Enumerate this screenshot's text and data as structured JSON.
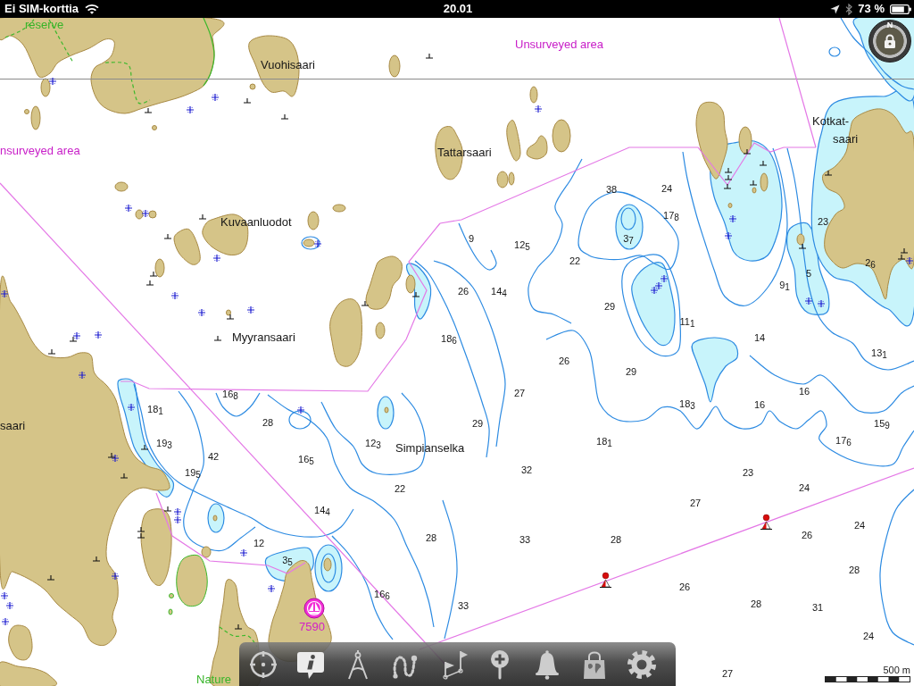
{
  "status_bar": {
    "carrier": "Ei SIM-korttia",
    "time": "20.01",
    "battery": "73 %"
  },
  "chart": {
    "labels": [
      {
        "text": "reserve",
        "kind": "reserve"
      },
      {
        "text": "Unsurveyed area",
        "kind": "area"
      },
      {
        "text": "Vuohisaari",
        "kind": "place"
      },
      {
        "text": "Kotkat-",
        "kind": "place"
      },
      {
        "text": "saari",
        "kind": "place"
      },
      {
        "text": "nsurveyed area",
        "kind": "area"
      },
      {
        "text": "Tattarsaari",
        "kind": "place"
      },
      {
        "text": "Kuvaanluodot",
        "kind": "place"
      },
      {
        "text": "Myyransaari",
        "kind": "place"
      },
      {
        "text": "saari",
        "kind": "place"
      },
      {
        "text": "Simpianselka",
        "kind": "place"
      },
      {
        "text": "Nature",
        "kind": "reserve"
      }
    ],
    "soundings": [
      "38",
      "24",
      "17$_{8}$",
      "23",
      "9",
      "12$_{5}$",
      "3$_{7}$",
      "22",
      "2$_{6}$",
      "5",
      "26",
      "14$_{4}$",
      "9$_{1}$",
      "29",
      "11$_{1}$",
      "18$_{6}$",
      "14",
      "26",
      "13$_{1}$",
      "29",
      "16$_{8}$",
      "27",
      "16",
      "18$_{1}$",
      "18$_{3}$",
      "16",
      "28",
      "29",
      "15$_{9}$",
      "19$_{3}$",
      "12$_{3}$",
      "18$_{1}$",
      "17$_{6}$",
      "42",
      "16$_{5}$",
      "19$_{5}$",
      "32",
      "23",
      "22",
      "24",
      "14$_{4}$",
      "27",
      "24",
      "12",
      "28",
      "33",
      "28",
      "26",
      "3$_{5}$",
      "28",
      "16$_{6}$",
      "26",
      "33",
      "28",
      "31",
      "24",
      "27"
    ],
    "waypoint": {
      "label": "7590"
    },
    "north_button": {
      "label": "N"
    },
    "scale": {
      "label": "500 m"
    }
  },
  "toolbar": {
    "buttons": [
      {
        "kind": "position"
      },
      {
        "kind": "info"
      },
      {
        "kind": "measure"
      },
      {
        "kind": "route"
      },
      {
        "kind": "flags"
      },
      {
        "kind": "marker"
      },
      {
        "kind": "alarm"
      },
      {
        "kind": "store"
      },
      {
        "kind": "settings"
      }
    ]
  }
}
